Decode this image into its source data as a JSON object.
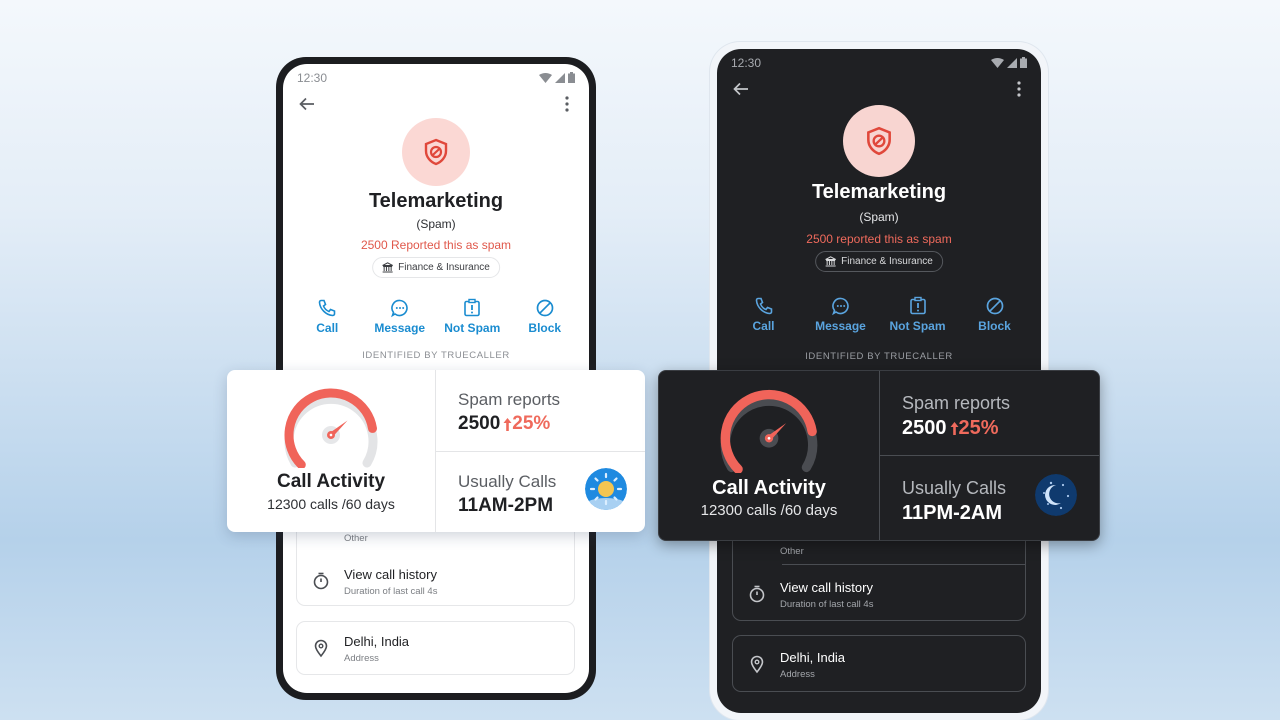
{
  "status_bar": {
    "time": "12:30"
  },
  "light_phone": {
    "contact_name": "Telemarketing",
    "label": "(Spam)",
    "spam_count_text": "2500 Reported this as spam",
    "category_chip": "Finance & Insurance",
    "actions": [
      {
        "label": "Call",
        "icon": "phone-icon"
      },
      {
        "label": "Message",
        "icon": "message-icon"
      },
      {
        "label": "Not Spam",
        "icon": "not-spam-icon"
      },
      {
        "label": "Block",
        "icon": "block-icon"
      }
    ],
    "identified_by": "IDENTIFIED BY TRUECALLER",
    "list_cards": [
      {
        "partial_caption": "Other"
      },
      {
        "title": "View call history",
        "caption": "Duration of last call 4s",
        "icon": "stopwatch-icon"
      },
      {
        "title": "Delhi, India",
        "caption": "Address",
        "icon": "location-pin-icon"
      }
    ]
  },
  "dark_phone": {
    "contact_name": "Telemarketing",
    "label": "(Spam)",
    "spam_count_text": "2500 reported this as spam",
    "category_chip": "Finance & Insurance",
    "actions": [
      {
        "label": "Call",
        "icon": "phone-icon"
      },
      {
        "label": "Message",
        "icon": "message-icon"
      },
      {
        "label": "Not Spam",
        "icon": "not-spam-icon"
      },
      {
        "label": "Block",
        "icon": "block-icon"
      }
    ],
    "identified_by": "IDENTIFIED BY TRUECALLER",
    "list_cards": [
      {
        "partial_caption": "Other"
      },
      {
        "title": "View call history",
        "caption": "Duration of last call 4s",
        "icon": "stopwatch-icon"
      },
      {
        "title": "Delhi, India",
        "caption": "Address",
        "icon": "location-pin-icon"
      }
    ]
  },
  "light_overlay": {
    "call_activity_title": "Call Activity",
    "call_activity_sub": "12300 calls /60 days",
    "gauge_level": 0.8,
    "spam_reports_label": "Spam reports",
    "spam_reports_value": "2500",
    "spam_reports_change": "25%",
    "usually_calls_label": "Usually Calls",
    "usually_calls_value": "11AM-2PM",
    "time_icon": "sun-icon"
  },
  "dark_overlay": {
    "call_activity_title": "Call Activity",
    "call_activity_sub": "12300 calls /60 days",
    "gauge_level": 0.8,
    "spam_reports_label": "Spam reports",
    "spam_reports_value": "2500",
    "spam_reports_change": "25%",
    "usually_calls_label": "Usually Calls",
    "usually_calls_value": "11PM-2AM",
    "time_icon": "moon-icon"
  },
  "colors": {
    "accent_blue_light": "#1a8cd0",
    "accent_blue_dark": "#5aa4df",
    "spam_red": "#e0584b",
    "gauge_red": "#f0645a",
    "avatar_bg": "#fbd8d4"
  }
}
